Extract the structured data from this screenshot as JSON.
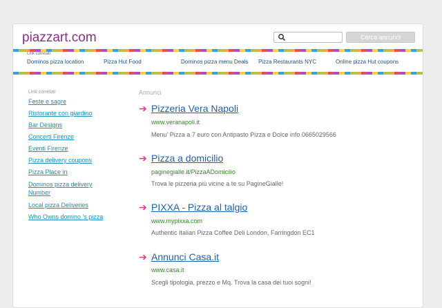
{
  "header": {
    "site_title": "piazzart.com",
    "search_placeholder": "",
    "search_button": "Cerca annunci",
    "accent_color": "#8a2d8a"
  },
  "topnav": {
    "label": "Link correlati",
    "items": [
      "Dominos pizza location",
      "Pizza Hut Food",
      "Dominos pizza menu Deals",
      "Pizza Restaurants NYC",
      "Online pizza Hut coupons"
    ]
  },
  "sidebar": {
    "label": "Link correlati",
    "items": [
      "Feste e sagre",
      "Ristorante con giardino",
      "Bar Designs",
      "Concerti Firenze",
      "Eventi Firenze",
      "Pizza delivery coupons",
      "Pizza Place in",
      "Dominos pizza delivery Number",
      "Local pizza Deliveries",
      "Who Owns domino 's pizza"
    ]
  },
  "ads": {
    "label": "Annunci",
    "arrow": "➔",
    "items": [
      {
        "title": "Pizzeria Vera Napoli",
        "url": "www.veranapoli.it",
        "description": "Menu' Pizza a 7 euro con Antipasto Pizza e Dolce info 0665029566"
      },
      {
        "title": "Pizza a domicilio",
        "url": "paginegialle.it/PizzaADomicilio",
        "description": "Trova le pizzeria più vicine a te su PagineGialle!"
      },
      {
        "title": "PIXXA - Pizza al talgio",
        "url": "www.mypixxa.com",
        "description": "Authentic Italian Pizza Coffee Deli London, Farringdon EC1"
      },
      {
        "title": "Annunci Casa.it",
        "url": "www.casa.it",
        "description": "Scegli tipologia, prezzo e Mq. Trova la casa dei tuoi sogni!"
      }
    ]
  }
}
